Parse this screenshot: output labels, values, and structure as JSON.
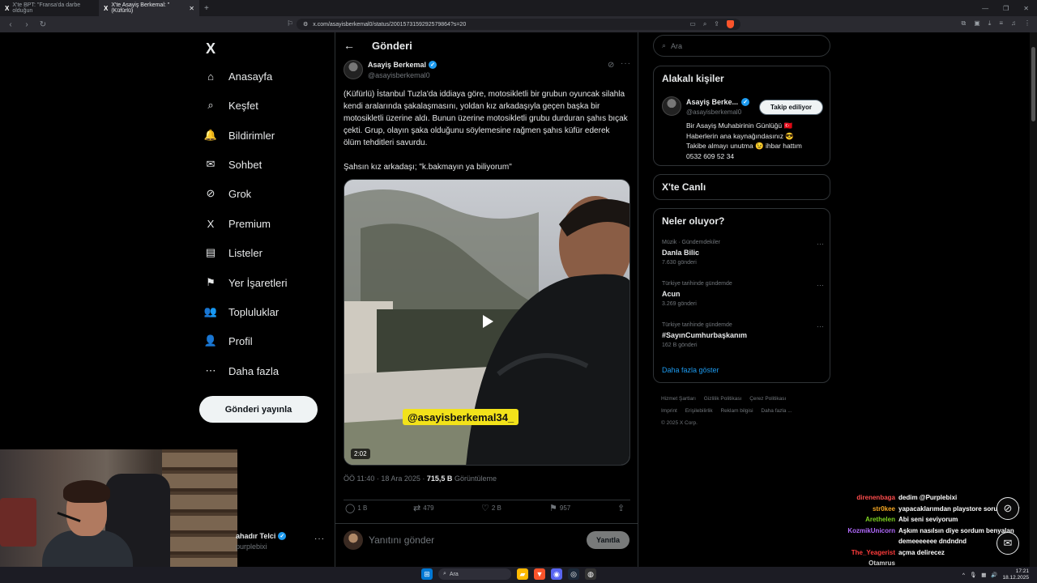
{
  "browser": {
    "tabs": [
      {
        "title": "X'te BPT: \"Fransa'da darbe olduğun"
      },
      {
        "title": "X'te Asayiş Berkemal: \"(Küfürlü)"
      }
    ],
    "new_tab": "+",
    "url": "x.com/asayisberkemal0/status/2001573159292579864?s=20"
  },
  "sidebar": {
    "logo": "X",
    "items": [
      {
        "label": "Anasayfa",
        "icon": "⌂"
      },
      {
        "label": "Keşfet",
        "icon": "⌕"
      },
      {
        "label": "Bildirimler",
        "icon": "🔔"
      },
      {
        "label": "Sohbet",
        "icon": "✉"
      },
      {
        "label": "Grok",
        "icon": "⊘"
      },
      {
        "label": "Premium",
        "icon": "X"
      },
      {
        "label": "Listeler",
        "icon": "▤"
      },
      {
        "label": "Yer İşaretleri",
        "icon": "⚑"
      },
      {
        "label": "Topluluklar",
        "icon": "👥"
      },
      {
        "label": "Profil",
        "icon": "👤"
      },
      {
        "label": "Daha fazla",
        "icon": "⋯"
      }
    ],
    "post_button": "Gönderi yayınla",
    "profile": {
      "name": "ahadır Telci",
      "handle": "purplebixi"
    }
  },
  "main": {
    "title": "Gönderi",
    "author": {
      "name": "Asayiş Berkemal",
      "handle": "@asayisberkemal0"
    },
    "text": "(Küfürlü) İstanbul Tuzla'da iddiaya göre, motosikletli bir grubun oyuncak silahla kendi aralarında şakalaşmasını, yoldan kız arkadaşıyla geçen başka bir motosikletli üzerine aldı. Bunun üzerine motosikletli grubu durduran şahıs bıçak çekti. Grup, olayın şaka olduğunu söylemesine rağmen şahıs küfür ederek ölüm tehditleri savurdu.\n\nŞahsın kız arkadaşı; \"k.bakmayın ya biliyorum\"",
    "video": {
      "overlay_text": "@asayisberkemal34_",
      "duration": "2:02"
    },
    "meta": {
      "time": "ÖÖ 11:40 · 18 Ara 2025 · ",
      "views": "715,5 B",
      "views_label": " Görüntüleme"
    },
    "actions": {
      "replies": "1 B",
      "reposts": "479",
      "likes": "2 B",
      "bookmarks": "957"
    },
    "reply": {
      "placeholder": "Yanıtını gönder",
      "button": "Yanıtla"
    }
  },
  "right": {
    "search_placeholder": "Ara",
    "related": {
      "title": "Alakalı kişiler",
      "name": "Asayiş Berke...",
      "handle": "@asayisberkemal0",
      "follow_button": "Takip ediliyor",
      "bio": "Bir Asayiş Muhabirinin Günlüğü 🇹🇷\nHaberlerin ana kaynağındasınız 😎\nTakibe almayı unutma 😉 ihbar hattım\n0532 609 52 34"
    },
    "live": {
      "title": "X'te Canlı"
    },
    "trends": {
      "title": "Neler oluyor?",
      "items": [
        {
          "meta": "Müzik · Gündemdekiler",
          "title": "Danla Bilic",
          "count": "7.630 gönderi"
        },
        {
          "meta": "Türkiye tarihinde gündemde",
          "title": "Acun",
          "count": "3.269 gönderi"
        },
        {
          "meta": "Türkiye tarihinde gündemde",
          "title": "#SayınCumhurbaşkanım",
          "count": "162 B gönderi"
        }
      ],
      "show_more": "Daha fazla göster"
    },
    "footer": [
      "Hizmet Şartları",
      "Gizlilik Politikası",
      "Çerez Politikası",
      "Imprint",
      "Erişilebilirlik",
      "Reklam bilgisi",
      "Daha fazla ...",
      "© 2025 X Corp."
    ]
  },
  "chat": [
    {
      "user": "direnenbaga",
      "msg": "dedim @Purplebixi",
      "color": "#ff4d4d"
    },
    {
      "user": "str0kee",
      "msg": "yapacaklarımdan playstore sorumludur",
      "color": "#f5a623"
    },
    {
      "user": "Arethelen",
      "msg": "Abi seni seviyorum",
      "color": "#7ed321"
    },
    {
      "user": "KozmikUnicorn",
      "msg": "Aşkım nasılsın diye sordum benyalan demeeeeeee dndndnd",
      "color": "#b36bff"
    },
    {
      "user": "The_Yeagerist",
      "msg": "açma delirecez",
      "color": "#ff3b3b"
    },
    {
      "user": "Otamrus",
      "msg": "",
      "color": "#d0d0d0"
    }
  ],
  "taskbar": {
    "search": "Ara",
    "time": "17:21",
    "date": "18.12.2025"
  }
}
